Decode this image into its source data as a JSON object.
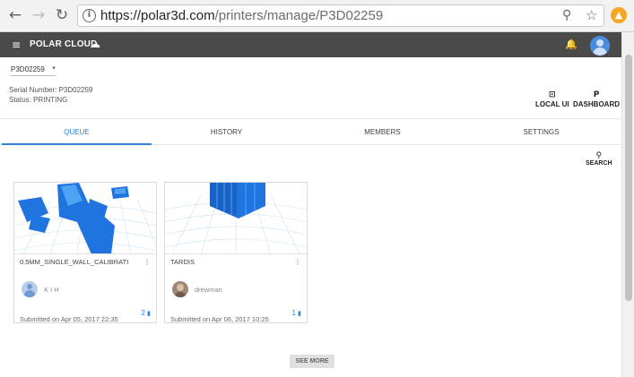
{
  "browser": {
    "url_host": "https://polar3d.com",
    "url_path": "/printers/manage/P3D02259",
    "back_glyph": "←",
    "forward_glyph": "→",
    "reload_glyph": "↻",
    "info_glyph": "i",
    "zoom_glyph": "⚲",
    "star_glyph": "☆",
    "extension_glyph": "▲"
  },
  "header": {
    "menu_glyph": "≡",
    "brand": "POLAR CLOUD",
    "cloud_glyph": "☁",
    "bell_glyph": "🔔"
  },
  "printer": {
    "selected": "P3D02259",
    "caret": "▾",
    "serial": "Serial Number: P3D02259",
    "status": "Status: PRINTING"
  },
  "actions": {
    "local_ui_glyph": "⊡",
    "local_ui": "LOCAL UI",
    "dashboard_glyph": "P",
    "dashboard": "DASHBOARD"
  },
  "tabs": [
    {
      "label": "QUEUE"
    },
    {
      "label": "HISTORY"
    },
    {
      "label": "MEMBERS"
    },
    {
      "label": "SETTINGS"
    }
  ],
  "search": {
    "glyph": "⚲",
    "label": "SEARCH"
  },
  "cards": [
    {
      "title": "0.5MM_SINGLE_WALL_CALIBRATI",
      "user": "K I H",
      "file_count": "2",
      "submitted": "Submitted on Apr 05, 2017 22:35"
    },
    {
      "title": "TARDIS",
      "user": "drewman",
      "file_count": "1",
      "submitted": "Submitted on Apr 06, 2017 10:25"
    }
  ],
  "kebab_glyph": "⋮",
  "file_glyph": "▮",
  "see_more": "SEE MORE",
  "colors": {
    "accent": "#2f80d6",
    "header_bg": "#4a4a4a",
    "model_blue": "#1f74e0"
  }
}
